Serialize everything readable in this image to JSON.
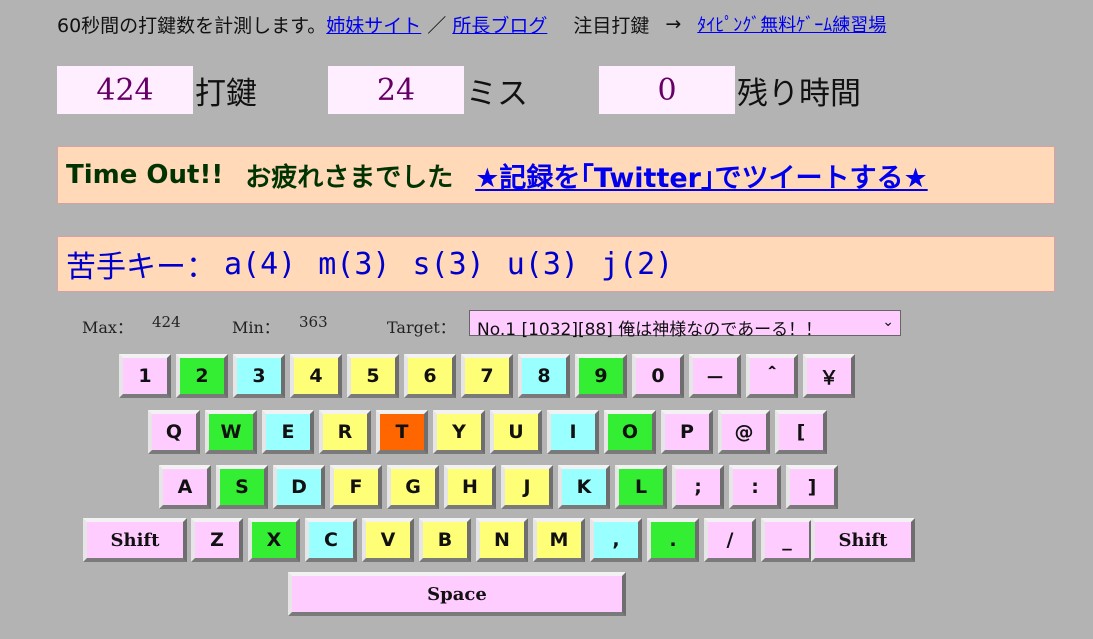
{
  "header": {
    "intro": "60秒間の打鍵数を計測します。",
    "sister_link": "姉妹サイト",
    "separator": "／",
    "blog_link": "所長ブログ",
    "featured": "注目打鍵",
    "arrow": "→",
    "game_link": "ﾀｲﾋﾟﾝｸﾞ無料ｹﾞｰﾑ練習場"
  },
  "stats": {
    "keystrokes": "424",
    "keystrokes_label": "打鍵",
    "misses": "24",
    "misses_label": "ミス",
    "remaining": "0",
    "remaining_label": "残り時間"
  },
  "result": {
    "timeout": "Time Out!!",
    "message": "お疲れさまでした",
    "tweet_link": "★記録を｢Twitter｣でツイートする★"
  },
  "weak_keys": {
    "label": "苦手キー：",
    "items": [
      "a(4)",
      "m(3)",
      "s(3)",
      "u(3)",
      "j(2)"
    ]
  },
  "metrics": {
    "max_label": "Max：",
    "max_value": "424",
    "min_label": "Min：",
    "min_value": "363",
    "target_label": "Target：",
    "target_selected": "No.1 [1032][88] 俺は神様なのであーる！！"
  },
  "keyboard": {
    "row1": [
      "1",
      "2",
      "3",
      "4",
      "5",
      "6",
      "7",
      "8",
      "9",
      "0",
      "－",
      "＾",
      "￥"
    ],
    "row2": [
      "Q",
      "W",
      "E",
      "R",
      "T",
      "Y",
      "U",
      "I",
      "O",
      "P",
      "@",
      "["
    ],
    "row3": [
      "A",
      "S",
      "D",
      "F",
      "G",
      "H",
      "J",
      "K",
      "L",
      ";",
      ":",
      "]"
    ],
    "row4": [
      "Shift",
      "Z",
      "X",
      "C",
      "V",
      "B",
      "N",
      "M",
      ",",
      ".",
      "/",
      "_",
      "Shift"
    ],
    "space": "Space"
  },
  "colors": {
    "pink": "#ffccff",
    "green": "#33ee33",
    "cyan": "#99ffff",
    "yellow": "#ffff77",
    "orange": "#ff6600"
  }
}
